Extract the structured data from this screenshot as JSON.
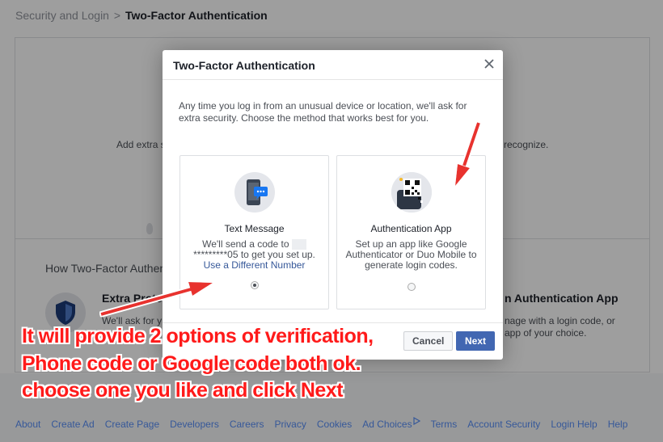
{
  "breadcrumb": {
    "parent": "Security and Login",
    "separator": ">",
    "current": "Two-Factor Authentication"
  },
  "background": {
    "add_extra": "Add extra s",
    "recognize": "recognize.",
    "how_heading": "How Two-Factor Authen",
    "extra_protection": "Extra Prote",
    "we_ask": "We'll ask for y",
    "auth_app_heading": "n Authentication App",
    "manage_line1": "nage with a login code, or",
    "manage_line2": "app of your choice."
  },
  "modal": {
    "title": "Two-Factor Authentication",
    "close_label": "×",
    "intro": "Any time you log in from an unusual device or location, we'll ask for extra security. Choose the method that works best for you.",
    "options": [
      {
        "title": "Text Message",
        "desc_line1": "We'll send a code to",
        "desc_line2": "*********05 to get you set up.",
        "link": "Use a Different Number",
        "selected": true
      },
      {
        "title": "Authentication App",
        "desc_line1": "Set up an app like Google",
        "desc_line2": "Authenticator or Duo Mobile to",
        "desc_line3": "generate login codes.",
        "selected": false
      }
    ],
    "cancel_label": "Cancel",
    "next_label": "Next"
  },
  "annotation": {
    "line1": "It will provide 2 options of verification,",
    "line2": "Phone code or Google code both ok.",
    "line3": "choose one you like and click Next",
    "color": "#ff1a1a"
  },
  "footer": {
    "links": [
      "About",
      "Create Ad",
      "Create Page",
      "Developers",
      "Careers",
      "Privacy",
      "Cookies",
      "Ad Choices",
      "Terms",
      "Account Security",
      "Login Help",
      "Help"
    ]
  },
  "colors": {
    "link": "#365899",
    "primary_button": "#4267b2"
  }
}
